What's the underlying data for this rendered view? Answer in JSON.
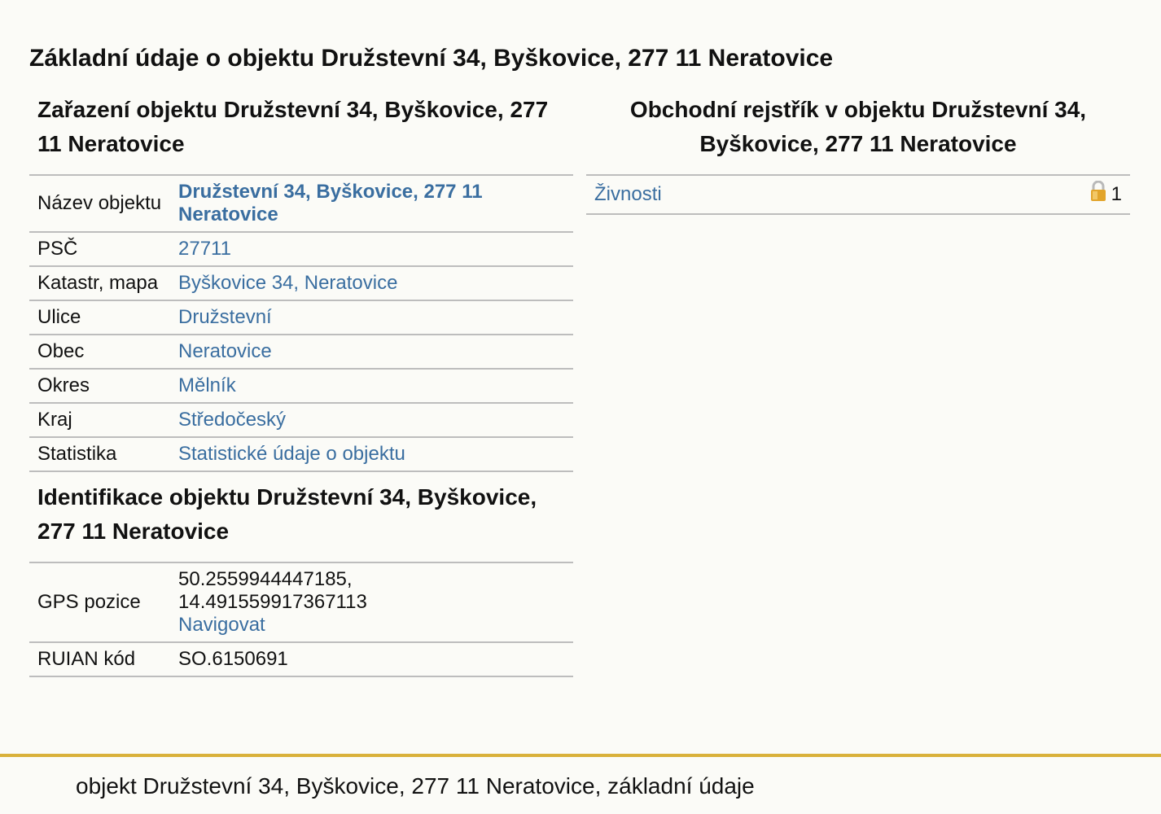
{
  "page_title": "Základní údaje o objektu Družstevní 34, Byškovice, 277 11 Neratovice",
  "classification": {
    "title": "Zařazení objektu Družstevní 34, Byškovice, 277 11 Neratovice",
    "rows": [
      {
        "label": "Název objektu",
        "value": "Družstevní 34, Byškovice, 277 11 Neratovice"
      },
      {
        "label": "PSČ",
        "value": "27711"
      },
      {
        "label": "Katastr, mapa",
        "value": "Byškovice 34, Neratovice"
      },
      {
        "label": "Ulice",
        "value": "Družstevní"
      },
      {
        "label": "Obec",
        "value": "Neratovice"
      },
      {
        "label": "Okres",
        "value": "Mělník"
      },
      {
        "label": "Kraj",
        "value": "Středočeský"
      },
      {
        "label": "Statistika",
        "value": "Statistické údaje o objektu"
      }
    ]
  },
  "identification": {
    "title": "Identifikace objektu Družstevní 34, Byškovice, 277 11 Neratovice",
    "gps_label": "GPS pozice",
    "gps_lat": "50.2559944447185,",
    "gps_lon": "14.491559917367113",
    "navigate_label": "Navigovat",
    "ruian_label": "RUIAN kód",
    "ruian_value": "SO.6150691"
  },
  "business_register": {
    "title": "Obchodní rejstřík v objektu Družstevní 34, Byškovice, 277 11 Neratovice",
    "item_label": "Živnosti",
    "item_count": "1",
    "lock_icon": "lock-icon",
    "lock_color": "#e2a52b"
  },
  "footer": {
    "text": "objekt Družstevní 34, Byškovice, 277 11 Neratovice, základní údaje",
    "rule_color": "#d9b13a"
  }
}
